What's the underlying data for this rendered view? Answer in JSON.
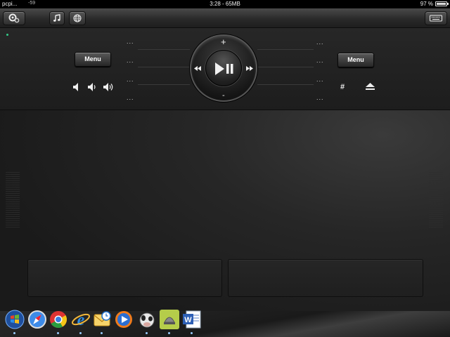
{
  "status_bar": {
    "carrier": "pcpi...",
    "signal": "-59",
    "center": "3:28 - 65MB",
    "battery_percent": "97 %"
  },
  "toolbar": {
    "buttons": [
      {
        "icon": "gear-icon"
      },
      {
        "icon": "music-note-icon"
      },
      {
        "icon": "globe-icon"
      },
      {
        "icon": "keyboard-icon"
      }
    ]
  },
  "remote": {
    "left_menu_label": "Menu",
    "right_menu_label": "Menu",
    "left_slots": [
      "...",
      "...",
      "...",
      "..."
    ],
    "right_slots": [
      "...",
      "...",
      "...",
      "..."
    ],
    "wheel": {
      "top": "+",
      "bottom": "-",
      "left_icon": "rewind-icon",
      "right_icon": "fast-forward-icon",
      "center_icon": "play-pause-icon"
    },
    "volume_icons": [
      "volume-low-icon",
      "volume-medium-icon",
      "volume-high-icon"
    ],
    "right_icons": [
      "hash-icon",
      "eject-icon"
    ]
  },
  "dock": {
    "items": [
      {
        "name": "windows-start-icon",
        "color": "#2a6fd6"
      },
      {
        "name": "safari-icon",
        "color": "#3d8be8"
      },
      {
        "name": "chrome-icon",
        "color": "#d33"
      },
      {
        "name": "internet-explorer-icon",
        "color": "#2c8be0"
      },
      {
        "name": "outlook-icon",
        "color": "#f2b73a"
      },
      {
        "name": "media-player-icon",
        "color": "#f07b1b"
      },
      {
        "name": "cow-app-icon",
        "color": "#ddd"
      },
      {
        "name": "lamp-app-icon",
        "color": "#b5cd4a"
      },
      {
        "name": "word-icon",
        "color": "#2d5fb5"
      }
    ]
  }
}
